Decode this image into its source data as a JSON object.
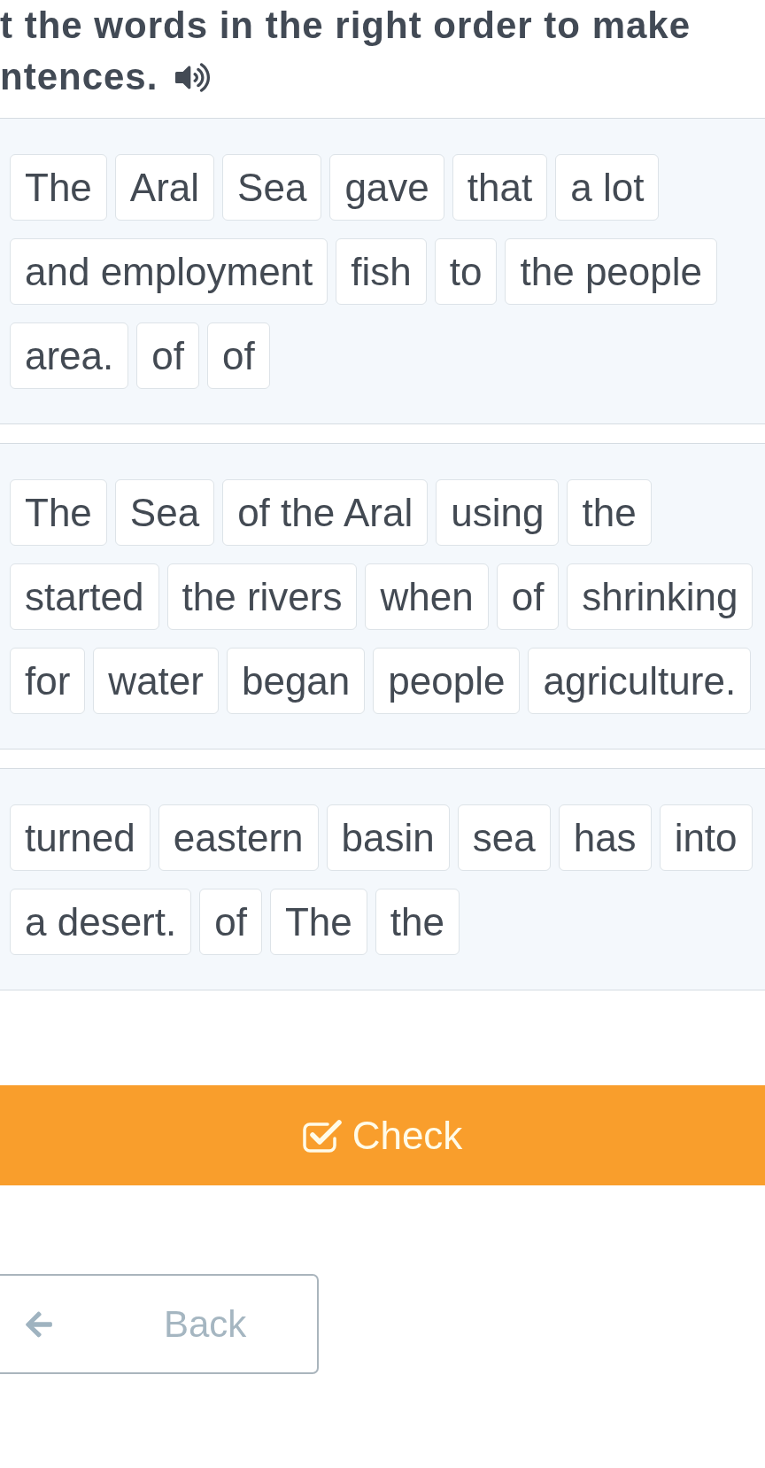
{
  "instruction": {
    "lines": [
      "t the words in the right order to make",
      "ntences."
    ]
  },
  "groups": [
    {
      "words": [
        "The",
        "Aral",
        "Sea",
        "gave",
        "that",
        "a lot",
        "and employment",
        "fish",
        "to",
        "the people",
        "area.",
        "of",
        "of"
      ]
    },
    {
      "words": [
        "The",
        "Sea",
        "of the Aral",
        "using",
        "the",
        "started",
        "the rivers",
        "when",
        "of",
        "shrinking",
        "for",
        "water",
        "began",
        "people",
        "agriculture."
      ]
    },
    {
      "words": [
        "turned",
        "eastern",
        "basin",
        "sea",
        "has",
        "into",
        "a desert.",
        "of",
        "The",
        "the"
      ]
    }
  ],
  "check_button": {
    "label": "Check"
  },
  "back_button": {
    "label": "Back"
  }
}
